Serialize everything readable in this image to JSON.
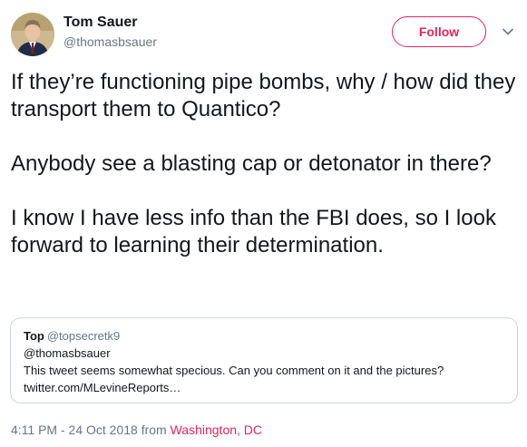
{
  "author": {
    "display_name": "Tom Sauer",
    "handle": "@thomasbsauer",
    "avatar_icon": "profile-photo"
  },
  "follow_button": {
    "label": "Follow",
    "color": "#e0245e"
  },
  "menu": {
    "icon": "chevron-down-icon"
  },
  "tweet": {
    "paragraphs": [
      "If they’re functioning pipe bombs, why / how did they transport them to Quantico?",
      "Anybody see a blasting cap or detonator in there?",
      "I know I have less info than the FBI does, so I look forward to learning their determination."
    ]
  },
  "quoted_tweet": {
    "name": "Top",
    "handle": "@topsecretk9",
    "reply_to": "@thomasbsauer",
    "text": "This tweet seems somewhat specious. Can you comment on it and the pictures?",
    "link": "twitter.com/MLevineReports…"
  },
  "meta": {
    "timestamp": "4:11 PM - 24 Oct 2018",
    "from_label": "from",
    "location": "Washington, DC"
  },
  "colors": {
    "accent": "#e0245e",
    "secondary_text": "#657786",
    "primary_text": "#14171a",
    "border": "#ccd6dd"
  }
}
